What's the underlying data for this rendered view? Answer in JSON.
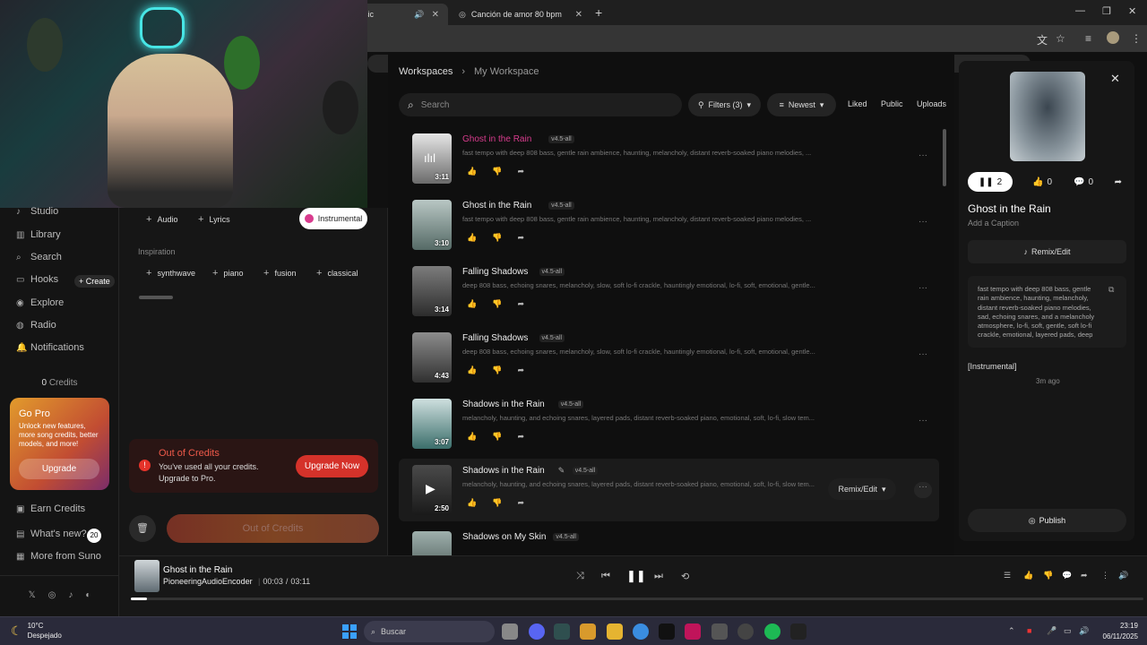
{
  "browser": {
    "tabs": [
      {
        "label": "sic",
        "icon": "speaker-icon"
      },
      {
        "label": "Canción de amor 80 bpm",
        "icon": "globe-icon"
      }
    ],
    "new_tab": "+"
  },
  "sidebar": {
    "nav": [
      {
        "label": "Studio",
        "icon": "studio-icon"
      },
      {
        "label": "Library",
        "icon": "library-icon"
      },
      {
        "label": "Search",
        "icon": "search-icon"
      },
      {
        "label": "Hooks",
        "icon": "hooks-icon"
      },
      {
        "label": "Explore",
        "icon": "explore-icon"
      },
      {
        "label": "Radio",
        "icon": "radio-icon"
      },
      {
        "label": "Notifications",
        "icon": "bell-icon"
      }
    ],
    "create_label": "+ Create",
    "credits_count": "0",
    "credits_label": "Credits",
    "gopro": {
      "title": "Go Pro",
      "desc": "Unlock new features, more song credits, better models, and more!",
      "button": "Upgrade"
    },
    "bottom": [
      {
        "label": "Earn Credits",
        "icon": "earn-icon"
      },
      {
        "label": "What's new?",
        "icon": "whats-new-icon"
      },
      {
        "label": "More from Suno",
        "icon": "more-icon"
      }
    ],
    "whats_new_badge": "20"
  },
  "create_panel": {
    "chips": [
      "Audio",
      "Lyrics"
    ],
    "instrumental": "Instrumental",
    "inspiration_label": "Inspiration",
    "inspiration": [
      "synthwave",
      "piano",
      "fusion",
      "classical"
    ],
    "out_of_credits": {
      "title": "Out of Credits",
      "desc": "You've used all your credits. Upgrade to Pro.",
      "button": "Upgrade Now"
    },
    "create_disabled": "Out of Credits"
  },
  "main": {
    "breadcrumb": [
      "Workspaces",
      "My Workspace"
    ],
    "search_placeholder": "Search",
    "filters": "Filters (3)",
    "sort": "Newest",
    "liked": "Liked",
    "public": "Public",
    "uploads": "Uploads",
    "remix_edit": "Remix/Edit",
    "songs": [
      {
        "title": "Ghost in the Rain",
        "version": "v4.5-all",
        "duration": "3:11",
        "desc": "fast tempo with deep 808 bass, gentle rain ambience, haunting, melancholy, distant reverb-soaked piano melodies, ...",
        "playing": true
      },
      {
        "title": "Ghost in the Rain",
        "version": "v4.5-all",
        "duration": "3:10",
        "desc": "fast tempo with deep 808 bass, gentle rain ambience, haunting, melancholy, distant reverb-soaked piano melodies, ..."
      },
      {
        "title": "Falling Shadows",
        "version": "v4.5-all",
        "duration": "3:14",
        "desc": "deep 808 bass, echoing snares, melancholy, slow, soft lo-fi crackle, hauntingly emotional, lo-fi, soft, emotional, gentle..."
      },
      {
        "title": "Falling Shadows",
        "version": "v4.5-all",
        "duration": "4:43",
        "desc": "deep 808 bass, echoing snares, melancholy, slow, soft lo-fi crackle, hauntingly emotional, lo-fi, soft, emotional, gentle..."
      },
      {
        "title": "Shadows in the Rain",
        "version": "v4.5-all",
        "duration": "3:07",
        "desc": "melancholy, haunting, and echoing snares, layered pads, distant reverb-soaked piano, emotional, soft, lo-fi, slow tem..."
      },
      {
        "title": "Shadows in the Rain",
        "version": "v4.5-all",
        "duration": "2:50",
        "desc": "melancholy, haunting, and echoing snares, layered pads, distant reverb-soaked piano, emotional, soft, lo-fi, slow tem...",
        "hovered": true
      },
      {
        "title": "Shadows on My Skin",
        "version": "v4.5-all",
        "duration": "",
        "desc": ""
      }
    ]
  },
  "right_panel": {
    "plays": "2",
    "likes": "0",
    "comments": "0",
    "title": "Ghost in the Rain",
    "caption": "Add a Caption",
    "remix_edit": "Remix/Edit",
    "prompt": "fast tempo with deep 808 bass, gentle rain ambience, haunting, melancholy, distant reverb-soaked piano melodies, sad, echoing snares, and a melancholy atmosphere, lo-fi, soft, gentle, soft lo-fi crackle, emotional, layered pads, deep",
    "tag": "[Instrumental]",
    "time_ago": "3m ago",
    "publish": "Publish"
  },
  "player": {
    "title": "Ghost in the Rain",
    "artist": "PioneeringAudioEncoder",
    "current": "00:03",
    "total": "03:11",
    "progress_fraction": 0.016
  },
  "taskbar": {
    "temp": "10°C",
    "weather": "Despejado",
    "search": "Buscar",
    "time": "23:19",
    "date": "06/11/2025"
  },
  "colors": {
    "accent_pink": "#d93c8e",
    "danger": "#d5322a"
  }
}
